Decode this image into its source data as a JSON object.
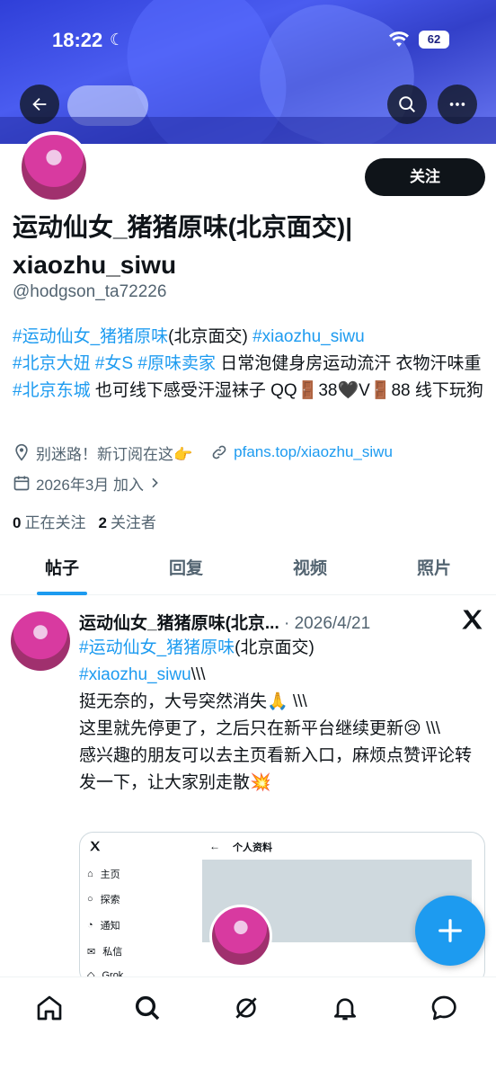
{
  "status_bar": {
    "time": "18:22",
    "moon": "☾",
    "battery": "62"
  },
  "profile": {
    "follow_label": "关注",
    "display_name": "运动仙女_猪猪原味(北京面交)| xiaozhu_siwu",
    "handle": "@hodgson_ta72226",
    "bio": {
      "tag1": "#运动仙女_猪猪原味",
      "text1": "(北京面交) ",
      "tag2": "#xiaozhu_siwu",
      "tag3": "#北京大妞",
      "tag4": "#女S",
      "tag5": "#原味卖家",
      "text2": " 日常泡健身房运动流汗 衣物汗味重 ",
      "tag6": "#北京东城",
      "text3": " 也可线下感受汗湿袜子 QQ🚪38🖤V🚪88 线下玩狗"
    },
    "location": "别迷路！新订阅在这👉",
    "link": "pfans.top/xiaozhu_siwu",
    "joined": "2026年3月 加入",
    "following_count": "0",
    "following_label": "正在关注",
    "followers_count": "2",
    "followers_label": "关注者"
  },
  "tabs": [
    "帖子",
    "回复",
    "视频",
    "照片"
  ],
  "post": {
    "name": "运动仙女_猪猪原味(北京...",
    "date": " · 2026/4/21",
    "tag1": "#运动仙女_猪猪原味",
    "text1": "(北京面交)",
    "tag2": "#xiaozhu_siwu",
    "text2": "\\\\\\",
    "line3": "挺无奈的，大号突然消失🙏 \\\\\\",
    "line4": "这里就先停更了，之后只在新平台继续更新😢 \\\\\\",
    "line5": "感兴趣的朋友可以去主页看新入口，麻烦点赞评论转发一下，让大家别走散💥"
  },
  "embedded_card": {
    "header": "个人资料",
    "sidebar": [
      "主页",
      "探索",
      "通知",
      "私信",
      "Grok"
    ]
  },
  "colors": {
    "accent": "#1d9bf0",
    "text": "#0f1419",
    "muted": "#536471"
  },
  "icons": {
    "back": "arrow-left-icon",
    "search": "search-icon",
    "more": "more-icon",
    "location": "location-pin-icon",
    "link": "link-icon",
    "calendar": "calendar-icon",
    "x_logo": "x-logo-icon",
    "compose": "plus-icon",
    "nav": [
      "home-icon",
      "search-icon",
      "grok-icon",
      "bell-icon",
      "messages-icon"
    ]
  }
}
